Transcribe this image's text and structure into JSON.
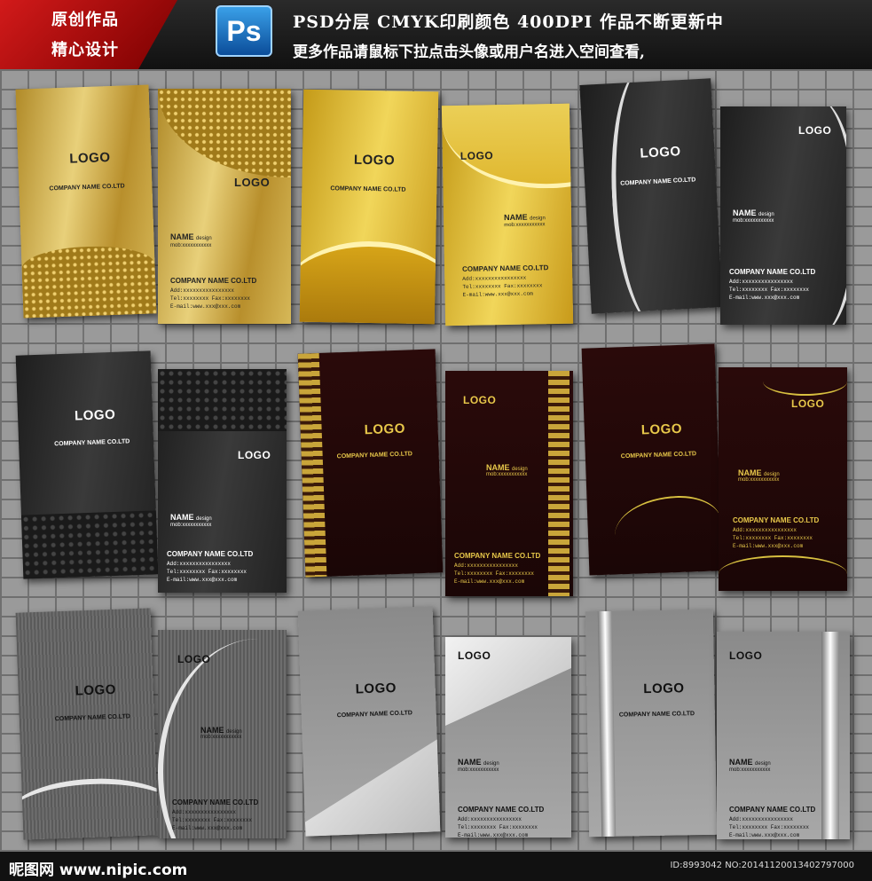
{
  "header": {
    "badge_line1": "原创作品",
    "badge_line2": "精心设计",
    "ps_icon": "Ps",
    "title": "PSD分层  CMYK印刷颜色  400DPI  作品不断更新中",
    "subtitle": "更多作品请鼠标下拉点击头像或用户名进入空间查看,"
  },
  "card_text": {
    "logo": "LOGO",
    "company": "COMPANY NAME CO.LTD",
    "name": "NAME",
    "design": "design",
    "mob": "mob:xxxxxxxxxxx",
    "add": "Add:xxxxxxxxxxxxxxxx",
    "tel": "Tel:xxxxxxxx Fax:xxxxxxxx",
    "email": "E-mail:www.xxx@xxx.com"
  },
  "footer": {
    "site": "昵图网 www.nipic.com",
    "id": "ID:8993042 NO:20141120013402797000"
  }
}
